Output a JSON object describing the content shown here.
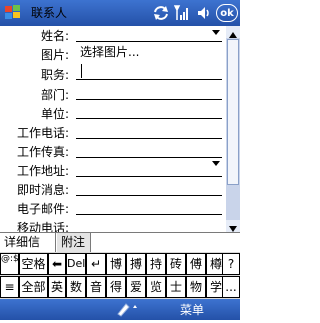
{
  "window": {
    "title": "联系人",
    "ok_label": "ok"
  },
  "form": {
    "fields": [
      {
        "label": "姓名:",
        "value": ""
      },
      {
        "label": "图片:",
        "value": "选择图片..."
      },
      {
        "label": "职务:",
        "value": ""
      },
      {
        "label": "部门:",
        "value": ""
      },
      {
        "label": "单位:",
        "value": ""
      },
      {
        "label": "工作电话:",
        "value": ""
      },
      {
        "label": "工作传真:",
        "value": ""
      },
      {
        "label": "工作地址:",
        "value": ""
      },
      {
        "label": "即时消息:",
        "value": ""
      },
      {
        "label": "电子邮件:",
        "value": ""
      },
      {
        "label": "移动电话:",
        "value": ""
      }
    ]
  },
  "tabs": [
    {
      "label": "详细信息"
    },
    {
      "label": "附注"
    }
  ],
  "keyboard": {
    "row1": [
      "@:$",
      "空格",
      "⬅",
      "Del",
      "↵",
      "博",
      "搏",
      "持",
      "砖",
      "傅",
      "樽",
      "?"
    ],
    "row2": [
      "≡",
      "全部",
      "英",
      "数",
      "音",
      "得",
      "爱",
      "览",
      "士",
      "物",
      "学",
      "..."
    ]
  },
  "bottom": {
    "menu_label": "菜单"
  },
  "colors": {
    "title_bar": "#2e5fb8",
    "scrollbar": "#c9d4ea"
  }
}
